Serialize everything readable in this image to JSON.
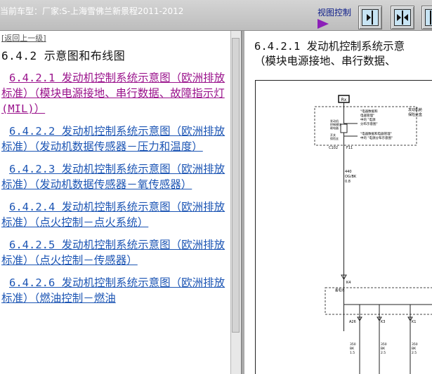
{
  "header": {
    "car_model": "当前车型：厂家:S-上海雪佛兰新景程2011-2012",
    "view_control": "视图控制"
  },
  "toolbar": {
    "buttons": [
      "panel-right-icon",
      "panel-split-icon",
      "panel-left-icon"
    ]
  },
  "left_panel": {
    "back_link": "[返回上一级]",
    "section_title": "6.4.2 示意图和布线图",
    "items": [
      {
        "label": "6.4.2.1 发动机控制系统示意图（欧洲排放标准）（模块电源接地、串行数据、故障指示灯(MIL)）",
        "active": true
      },
      {
        "label": "6.4.2.2 发动机控制系统示意图（欧洲排放标准）（发动机数据传感器－压力和温度）",
        "active": false
      },
      {
        "label": "6.4.2.3 发动机控制系统示意图（欧洲排放标准）（发动机数据传感器－氧传感器）",
        "active": false
      },
      {
        "label": "6.4.2.4 发动机控制系统示意图（欧洲排放标准）（点火控制－点火系统）",
        "active": false
      },
      {
        "label": "6.4.2.5 发动机控制系统示意图（欧洲排放标准）（点火控制－传感器）",
        "active": false
      },
      {
        "label": "6.4.2.6 发动机控制系统示意图（欧洲排放标准）（燃油控制－燃油",
        "active": false
      }
    ]
  },
  "right_panel": {
    "title_line1": "6.4.2.1 发动机控制系统示意",
    "title_line2": "（模块电源接地、串行数据、",
    "diagram": {
      "fuse_label": "Rx",
      "side_note_1": "发动机舱",
      "side_note_2": "保险丝盒",
      "box_note_1": "\"电器数据和",
      "box_note_2": "电器管理\"",
      "box_note_3": "中的 \"电源",
      "box_note_4": "分布示意图\"",
      "box_note_5": "\"电器数据和电器管理\"",
      "box_note_6": "中的 \"电源分布示意图\"",
      "relay_1": "发动机",
      "relay_2": "控制模块",
      "relay_3": "继电器",
      "relay_4": "开关",
      "relay_5": "保险丝",
      "connector_top": "C102",
      "connector_pin": "F11",
      "wire_1": "440",
      "wire_2": "OG/BK",
      "wire_3": "0.8",
      "connector_k4": "K4",
      "module_label": "蓄电池",
      "pin_a": "A26",
      "pin_b": "K3",
      "pin_c": "K1",
      "w1_num": "350",
      "w1_col": "BK",
      "w1_gauge": "1.5",
      "w2_num": "350",
      "w2_col": "BK",
      "w2_gauge": "2.5",
      "w3_num": "350",
      "w3_col": "BK",
      "w3_gauge": "2.5"
    }
  }
}
